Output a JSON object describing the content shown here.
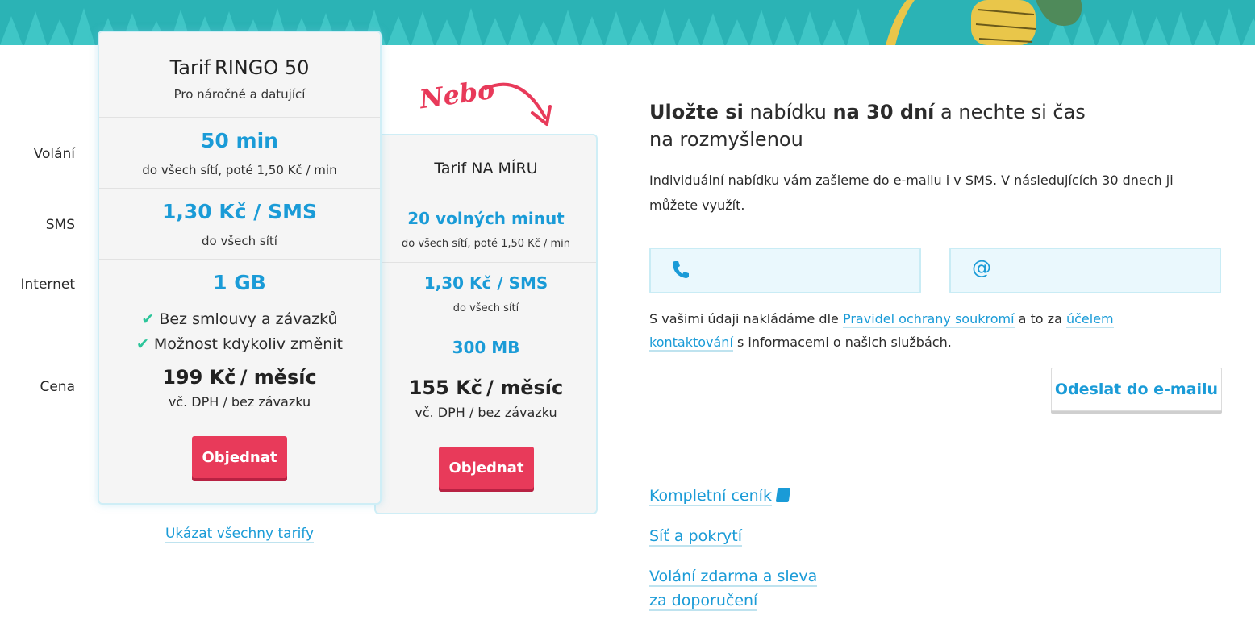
{
  "row_labels": [
    "Volání",
    "SMS",
    "Internet",
    "Cena"
  ],
  "card1": {
    "title_main": "Tarif",
    "title_small": "RINGO 50",
    "subtitle": "Pro náročné a datující",
    "calls_value": "50 min",
    "calls_note": "do všech sítí, poté 1,50 Kč / min",
    "sms_value": "1,30 Kč / SMS",
    "sms_note": "do všech sítí",
    "data_value": "1 GB",
    "features": [
      "Bez smlouvy a závazků",
      "Možnost kdykoliv změnit"
    ],
    "price": "199 Kč",
    "price_unit": "/ měsíc",
    "vat_note": "vč. DPH / bez závazku",
    "order_label": "Objednat"
  },
  "nebo_label": "Nebo",
  "card2": {
    "title": "Tarif NA MÍRU",
    "calls_value": "20 volných minut",
    "calls_note": "do všech sítí, poté 1,50 Kč / min",
    "sms_value": "1,30 Kč / SMS",
    "sms_note": "do všech sítí",
    "data_value": "300 MB",
    "price": "155 Kč",
    "price_unit": "/ měsíc",
    "vat_note": "vč. DPH / bez závazku",
    "order_label": "Objednat"
  },
  "show_all_link": "Ukázat všechny tarify",
  "offer": {
    "headline_bold1": "Uložte si",
    "headline_text1": "nabídku",
    "headline_bold2": "na 30 dní",
    "headline_text2": "a nechte si čas",
    "headline_text3": "na rozmyšlenou",
    "description": "Individuální nabídku vám zašleme do e-mailu i v SMS. V následujících 30 dnech ji můžete využít.",
    "phone_icon": "phone-icon",
    "email_icon": "at-icon",
    "privacy_prefix": "S vašimi údaji nakládáme dle",
    "privacy_link1": "Pravidel ochrany soukromí",
    "privacy_middle": "a to za",
    "privacy_link2a": "účelem",
    "privacy_link2b": "kontaktování",
    "privacy_suffix": "s informacemi o našich službách.",
    "send_button": "Odeslat do e-mailu"
  },
  "side_links": {
    "pricelist": "Kompletní ceník",
    "coverage": "Síť a pokrytí",
    "referral_line1": "Volání zdarma a sleva",
    "referral_line2": "za doporučení"
  },
  "colors": {
    "accent_blue": "#1a9bd7",
    "order_red": "#e83a5a",
    "banner_teal": "#2bb3b5",
    "check_green": "#2cc59a"
  }
}
